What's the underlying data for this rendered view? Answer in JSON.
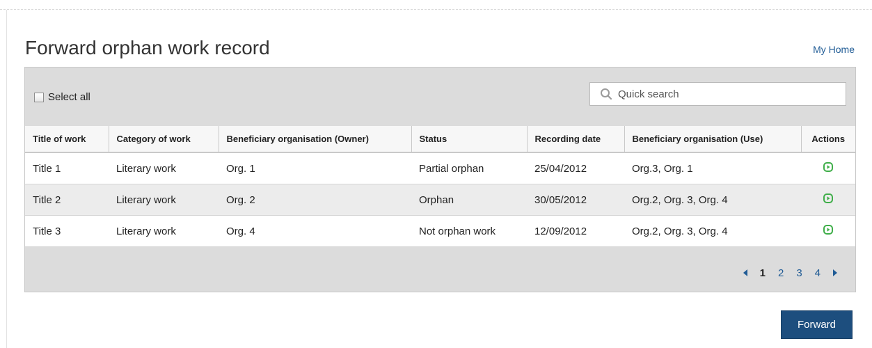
{
  "page": {
    "title": "Forward orphan work record",
    "home_link": "My Home"
  },
  "toolbar": {
    "select_all_label": "Select all",
    "search_placeholder": "Quick search"
  },
  "table": {
    "columns": [
      "Title of work",
      "Category of work",
      "Beneficiary organisation (Owner)",
      "Status",
      "Recording date",
      "Beneficiary organisation (Use)",
      "Actions"
    ],
    "rows": [
      [
        "Title 1",
        "Literary work",
        "Org. 1",
        "Partial orphan",
        "25/04/2012",
        "Org.3, Org. 1"
      ],
      [
        "Title 2",
        "Literary work",
        "Org. 2",
        "Orphan",
        "30/05/2012",
        "Org.2, Org. 3, Org. 4"
      ],
      [
        "Title 3",
        "Literary work",
        "Org. 4",
        "Not orphan work",
        "12/09/2012",
        "Org.2, Org. 3, Org. 4"
      ]
    ],
    "row_action_icon": "play-circle-icon"
  },
  "pagination": {
    "pages": [
      "1",
      "2",
      "3",
      "4"
    ],
    "current": "1"
  },
  "footer": {
    "forward_label": "Forward"
  },
  "colors": {
    "accent": "#1d4e7e",
    "link": "#1f5b95",
    "action_icon": "#3fae49",
    "panel_bg": "#dcdcdc"
  }
}
